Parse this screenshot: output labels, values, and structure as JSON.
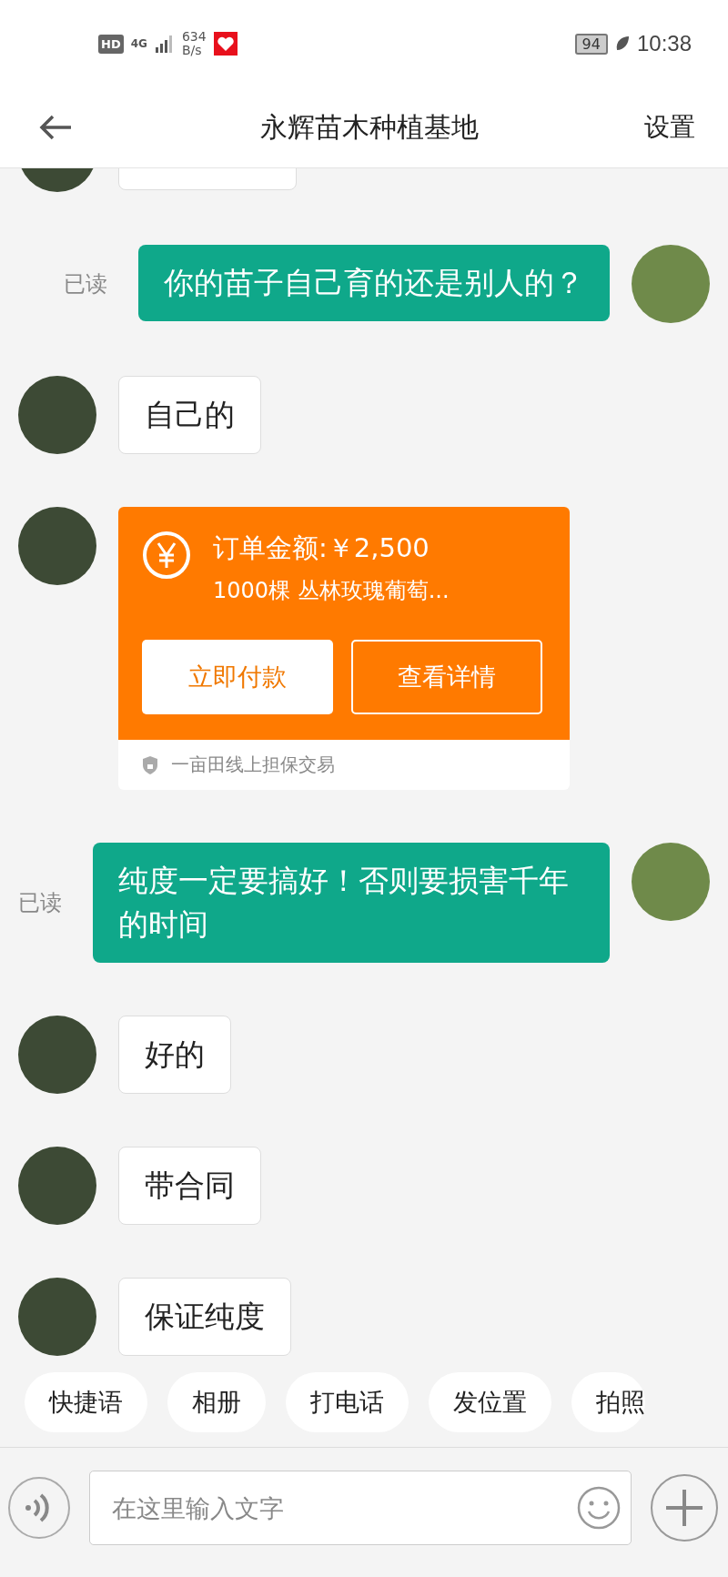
{
  "status_bar": {
    "hd": "HD",
    "network": "4G",
    "speed_value": "634",
    "speed_unit": "B/s",
    "battery": "94",
    "time": "10:38"
  },
  "header": {
    "title": "永辉苗木种植基地",
    "action": "设置"
  },
  "messages": [
    {
      "kind": "clipped"
    },
    {
      "kind": "sent",
      "text": "你的苗子自己育的还是别人的？",
      "read_label": "已读"
    },
    {
      "kind": "received",
      "text": "自己的"
    },
    {
      "kind": "order",
      "amount": "订单金额:￥2,500",
      "item": "1000棵 丛林玫瑰葡萄...",
      "pay_button": "立即付款",
      "detail_button": "查看详情",
      "guarantee": "一亩田线上担保交易"
    },
    {
      "kind": "sent",
      "text": "纯度一定要搞好！否则要损害千年的时间",
      "read_label": "已读"
    },
    {
      "kind": "received",
      "text": "好的"
    },
    {
      "kind": "received",
      "text": "带合同"
    },
    {
      "kind": "received",
      "text": "保证纯度"
    }
  ],
  "quick_actions": [
    "快捷语",
    "相册",
    "打电话",
    "发位置",
    "拍照"
  ],
  "input": {
    "placeholder": "在这里输入文字"
  }
}
